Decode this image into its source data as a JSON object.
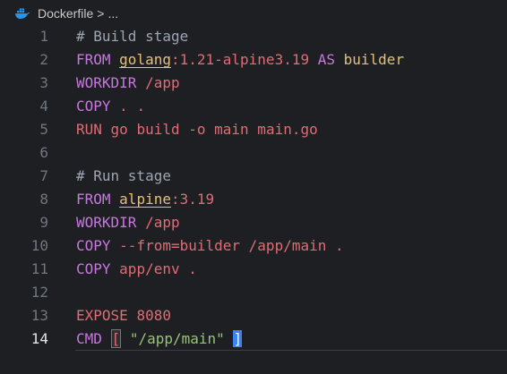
{
  "breadcrumb": {
    "file": "Dockerfile",
    "separator": ">",
    "more": "..."
  },
  "line_numbers": [
    "1",
    "2",
    "3",
    "4",
    "5",
    "6",
    "7",
    "8",
    "9",
    "10",
    "11",
    "12",
    "13",
    "14"
  ],
  "code": {
    "l1_comment": "# Build stage",
    "l2_from": "FROM",
    "l2_image": "golang",
    "l2_tag": ":1.21-alpine3.19",
    "l2_as": "AS",
    "l2_alias": "builder",
    "l3_workdir": "WORKDIR",
    "l3_path": "/app",
    "l4_copy": "COPY",
    "l4_args": ". .",
    "l5_run": "RUN",
    "l5_cmd": "go build -o main main.go",
    "l7_comment": "# Run stage",
    "l8_from": "FROM",
    "l8_image": "alpine",
    "l8_tag": ":3.19",
    "l9_workdir": "WORKDIR",
    "l9_path": "/app",
    "l10_copy": "COPY",
    "l10_args": "--from=builder /app/main .",
    "l11_copy": "COPY",
    "l11_args": "app/env .",
    "l13_expose": "EXPOSE",
    "l13_port": "8080",
    "l14_cmd": "CMD",
    "l14_open": "[",
    "l14_string": "\"/app/main\"",
    "l14_close": "]"
  },
  "active_line": "14",
  "colors": {
    "background": "#1e1f22",
    "keyword": "#c678dd",
    "instruction": "#e06c75",
    "string": "#98c379",
    "image": "#e5c07b",
    "cursor": "#3b82f6"
  },
  "icons": {
    "file": "docker-whale-icon"
  }
}
